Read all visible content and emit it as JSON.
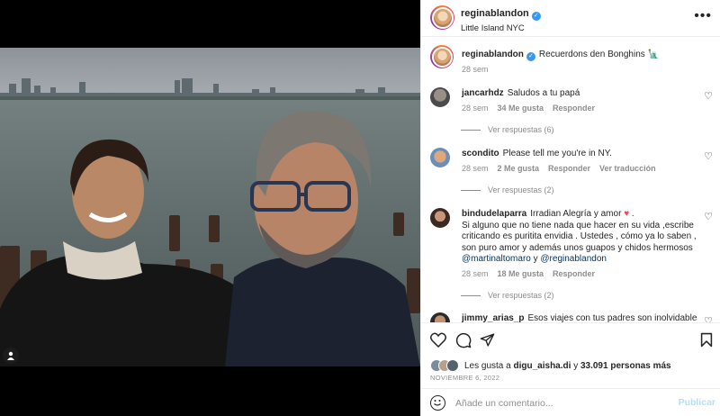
{
  "post": {
    "author": "reginablandon",
    "location": "Little Island NYC",
    "caption_user": "reginablandon",
    "caption_text": "Recuerdons den Bonghins 🗽",
    "caption_time": "28 sem"
  },
  "comments": [
    {
      "user": "jancarhdz",
      "text": "Saludos a tu papá",
      "time": "28 sem",
      "likes": "34 Me gusta",
      "reply": "Responder",
      "translate": "",
      "replies": "Ver respuestas (6)"
    },
    {
      "user": "scondito",
      "text": "Please tell me you're in NY.",
      "time": "28 sem",
      "likes": "2 Me gusta",
      "reply": "Responder",
      "translate": "Ver traducción",
      "replies": "Ver respuestas (2)"
    },
    {
      "user": "bindudelaparra",
      "text_line1": "Irradian Alegría y amor",
      "heart": "♥",
      "text_rest": "Si alguno que no tiene nada que hacer en su vida ,escribe criticando es puritita envidia . Ustedes , cómo ya lo saben , son puro amor y además unos guapos y chidos hermosos",
      "mention1": "@martinaltomaro",
      "and": "y",
      "mention2": "@reginablandon",
      "time": "28 sem",
      "likes": "18 Me gusta",
      "reply": "Responder",
      "replies": "Ver respuestas (2)"
    },
    {
      "user": "jimmy_arias_p",
      "text": "Esos viajes con tus padres son inolvidables, se"
    }
  ],
  "footer": {
    "likes_prefix": "Les gusta a",
    "likes_user": "digu_aisha.di",
    "likes_mid": "y",
    "likes_count": "33.091 personas más",
    "date": "NOVIEMBRE 6, 2022",
    "comment_placeholder": "Añade un comentario...",
    "publish": "Publicar"
  },
  "icons": [
    "more-options-icon",
    "verified-icon",
    "heart-icon",
    "comment-icon",
    "share-icon",
    "bookmark-icon",
    "emoji-icon",
    "tag-person-icon",
    "statue-of-liberty-emoji"
  ],
  "colors": {
    "verified": "#3897f0",
    "heart_red": "#ed4956",
    "publish": "#b2dffc",
    "mention": "#00376b",
    "muted": "#8e8e8e"
  }
}
